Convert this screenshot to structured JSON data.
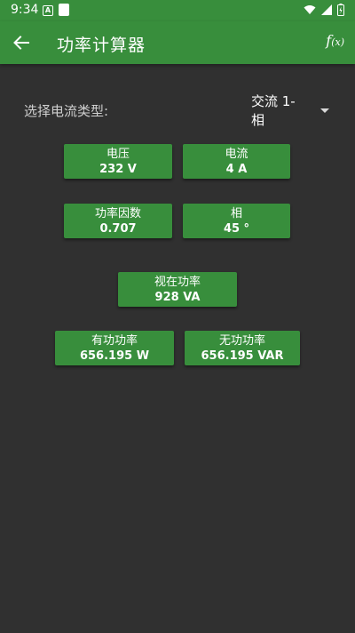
{
  "status_bar": {
    "time": "9:34",
    "notification_icon_letter": "A"
  },
  "app_bar": {
    "back_icon": "arrow-left-icon",
    "title": "功率计算器",
    "formula_main": "f",
    "formula_sub": "(x)"
  },
  "current_type": {
    "label": "选择电流类型:",
    "selected": "交流 1-相"
  },
  "values": {
    "voltage": {
      "label": "电压",
      "value": "232 V"
    },
    "current": {
      "label": "电流",
      "value": "4 A"
    },
    "power_factor": {
      "label": "功率因数",
      "value": "0.707"
    },
    "phase": {
      "label": "相",
      "value": "45 °"
    },
    "apparent_power": {
      "label": "视在功率",
      "value": "928 VA"
    },
    "active_power": {
      "label": "有功功率",
      "value": "656.195 W"
    },
    "reactive_power": {
      "label": "无功功率",
      "value": "656.195 VAR"
    }
  },
  "colors": {
    "primary": "#388e3c",
    "background": "#303030"
  }
}
